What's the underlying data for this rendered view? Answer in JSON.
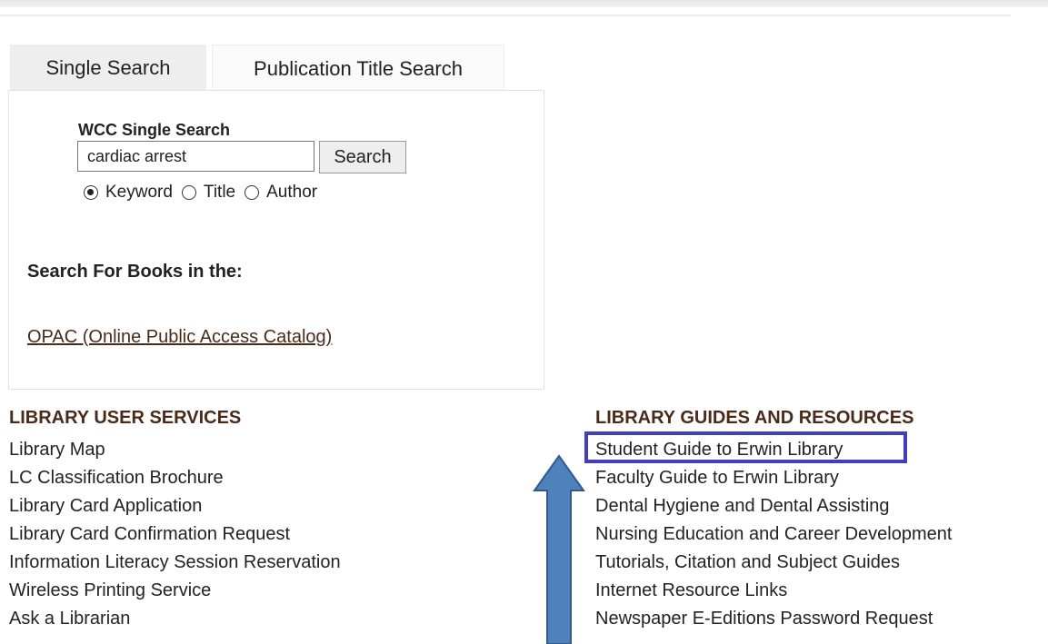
{
  "tabs": {
    "single_search": "Single Search",
    "publication_title_search": "Publication Title Search"
  },
  "search": {
    "label": "WCC Single Search",
    "value": "cardiac arrest",
    "button": "Search",
    "options": [
      "Keyword",
      "Title",
      "Author"
    ],
    "selected": "Keyword"
  },
  "books": {
    "heading": "Search For Books in the:",
    "opac_link": "OPAC (Online Public Access Catalog)"
  },
  "user_services": {
    "heading": "LIBRARY USER SERVICES",
    "links": [
      "Library Map",
      "LC Classification Brochure",
      "Library Card Application",
      "Library Card Confirmation Request",
      "Information Literacy Session Reservation",
      "Wireless Printing Service",
      "Ask a Librarian"
    ]
  },
  "guides": {
    "heading": "LIBRARY GUIDES AND RESOURCES",
    "links": [
      "Student Guide to Erwin Library",
      "Faculty Guide to Erwin Library",
      "Dental Hygiene and Dental Assisting",
      "Nursing Education and Career Development",
      "Tutorials, Citation and Subject Guides",
      "Internet Resource Links",
      "Newspaper E-Editions Password Request"
    ]
  },
  "annotation": {
    "highlight_color": "#3f3fc0",
    "arrow_color": "#4f81bd"
  }
}
